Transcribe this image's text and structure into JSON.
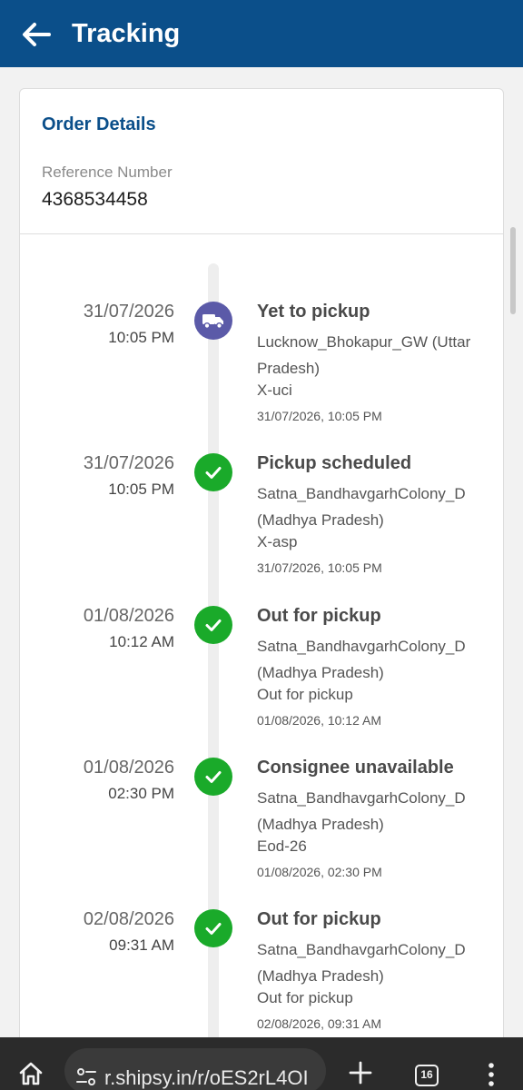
{
  "header": {
    "title": "Tracking"
  },
  "order": {
    "title": "Order Details",
    "reference_label": "Reference Number",
    "reference_value": "4368534458"
  },
  "events": [
    {
      "date": "31/07/2026",
      "time": "10:05 PM",
      "status": "Yet to pickup",
      "location": "Lucknow_Bhokapur_GW (Uttar Pradesh)",
      "note": "X-uci",
      "timestamp": "31/07/2026, 10:05 PM",
      "icon": "truck-icon"
    },
    {
      "date": "31/07/2026",
      "time": "10:05 PM",
      "status": "Pickup scheduled",
      "location": "Satna_BandhavgarhColony_D (Madhya Pradesh)",
      "note": "X-asp",
      "timestamp": "31/07/2026, 10:05 PM",
      "icon": "check-icon"
    },
    {
      "date": "01/08/2026",
      "time": "10:12 AM",
      "status": "Out for pickup",
      "location": "Satna_BandhavgarhColony_D (Madhya Pradesh)",
      "note": "Out for pickup",
      "timestamp": "01/08/2026, 10:12 AM",
      "icon": "check-icon"
    },
    {
      "date": "01/08/2026",
      "time": "02:30 PM",
      "status": "Consignee unavailable",
      "location": "Satna_BandhavgarhColony_D (Madhya Pradesh)",
      "note": "Eod-26",
      "timestamp": "01/08/2026, 02:30 PM",
      "icon": "check-icon"
    },
    {
      "date": "02/08/2026",
      "time": "09:31 AM",
      "status": "Out for pickup",
      "location": "Satna_BandhavgarhColony_D (Madhya Pradesh)",
      "note": "Out for pickup",
      "timestamp": "02/08/2026, 09:31 AM",
      "icon": "check-icon"
    }
  ],
  "browser": {
    "url": "r.shipsy.in/r/oES2rL4OI",
    "tab_count": "16"
  },
  "colors": {
    "header": "#0b4f8a",
    "truck_badge": "#5b5aa8",
    "check_badge": "#1aaa2a"
  }
}
